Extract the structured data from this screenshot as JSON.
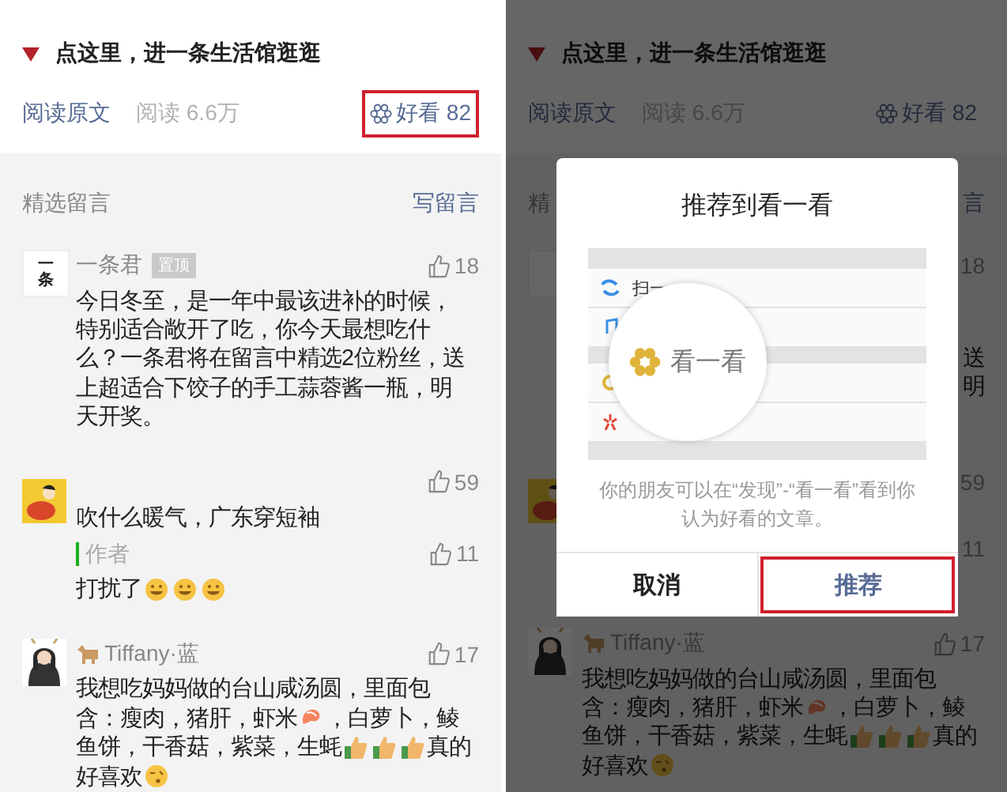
{
  "panels": [
    {
      "kind": "article",
      "promo": "点这里，进一条生活馆逛逛",
      "read_original": "阅读原文",
      "reads": "阅读 6.6万",
      "like_label": "好看 82",
      "like_highlighted": true,
      "section_label": "精选留言",
      "write_comment": "写留言",
      "comments": [
        {
          "kind": "full",
          "avatar": {
            "kind": "logo",
            "text": "一条"
          },
          "name": "一条君",
          "name_icon": false,
          "badge": "置顶",
          "likes": "18",
          "lines": [
            [
              {
                "kind": "text",
                "text": "今日冬至，是一年中最该进补的时候，"
              }
            ],
            [
              {
                "kind": "text",
                "text": "特别适合敞开了吃，你今天最想吃什"
              }
            ],
            [
              {
                "kind": "text",
                "text": "么？一条君将在留言中精选2位粉丝，送"
              }
            ],
            [
              {
                "kind": "text",
                "text": "上超适合下饺子的手工蒜蓉酱一瓶，明"
              }
            ],
            [
              {
                "kind": "text",
                "text": "天开奖。"
              }
            ]
          ]
        },
        {
          "kind": "full",
          "avatar": {
            "kind": "cartoon"
          },
          "name_icon": false,
          "likes": "59",
          "lines": [
            [
              {
                "kind": "text",
                "text": "吹什么暖气，广东穿短袖"
              }
            ]
          ],
          "reply": {
            "label": "作者",
            "likes": "11",
            "lines": [
              [
                {
                  "kind": "text",
                  "text": "打扰了"
                },
                {
                  "kind": "blush"
                },
                {
                  "kind": "blush"
                },
                {
                  "kind": "blush"
                }
              ]
            ]
          }
        },
        {
          "kind": "full",
          "avatar": {
            "kind": "person"
          },
          "name": "Tiffany·蓝",
          "name_icon": true,
          "likes": "17",
          "lines": [
            [
              {
                "kind": "text",
                "text": "我想吃妈妈做的台山咸汤圆，里面包"
              }
            ],
            [
              {
                "kind": "text",
                "text": "含：瘦肉，猪肝，虾米"
              },
              {
                "kind": "shrimp"
              },
              {
                "kind": "text",
                "text": "，白萝卜，鲮"
              }
            ],
            [
              {
                "kind": "text",
                "text": "鱼饼，干香菇，紫菜，生蚝"
              },
              {
                "kind": "thumb"
              },
              {
                "kind": "thumb"
              },
              {
                "kind": "thumb"
              },
              {
                "kind": "text",
                "text": "真的"
              }
            ],
            [
              {
                "kind": "text",
                "text": "好喜欢"
              },
              {
                "kind": "kiss"
              }
            ]
          ]
        }
      ]
    },
    {
      "kind": "dialog",
      "promo": "点这里，进一条生活馆逛逛",
      "read_original": "阅读原文",
      "reads": "阅读 6.6万",
      "like_label": "好看 82",
      "like_highlighted": false,
      "section_label": "精",
      "write_comment": "言",
      "comments": [
        {
          "kind": "covered",
          "avatar": {
            "kind": "logo"
          },
          "likes": "18",
          "fragments": [
            "送",
            "明"
          ]
        },
        {
          "kind": "covered",
          "avatar": {
            "kind": "cartoon"
          },
          "likes": "59",
          "reply": {
            "likes": "11"
          }
        },
        {
          "kind": "full",
          "avatar": {
            "kind": "person"
          },
          "name": "Tiffany·蓝",
          "name_icon": true,
          "likes": "17",
          "lines": [
            [
              {
                "kind": "text",
                "text": "我想吃妈妈做的台山咸汤圆，里面包"
              }
            ],
            [
              {
                "kind": "text",
                "text": "含：瘦肉，猪肝，虾米"
              },
              {
                "kind": "shrimp"
              },
              {
                "kind": "text",
                "text": "，白萝卜，鲮"
              }
            ],
            [
              {
                "kind": "text",
                "text": "鱼饼，干香菇，紫菜，生蚝"
              },
              {
                "kind": "thumb"
              },
              {
                "kind": "thumb"
              },
              {
                "kind": "thumb"
              },
              {
                "kind": "text",
                "text": "真的"
              }
            ],
            [
              {
                "kind": "text",
                "text": "好喜欢"
              },
              {
                "kind": "kiss"
              }
            ]
          ]
        }
      ],
      "dialog": {
        "title": "推荐到看一看",
        "illustration_row": "扫一",
        "illustration_focus": "看一看",
        "caption": "你的朋友可以在“发现”-“看一看”看到你认为好看的文章。",
        "buttons": [
          {
            "label": "取消",
            "primary": false,
            "highlighted": false
          },
          {
            "label": "推荐",
            "primary": true,
            "highlighted": true
          }
        ]
      }
    }
  ]
}
